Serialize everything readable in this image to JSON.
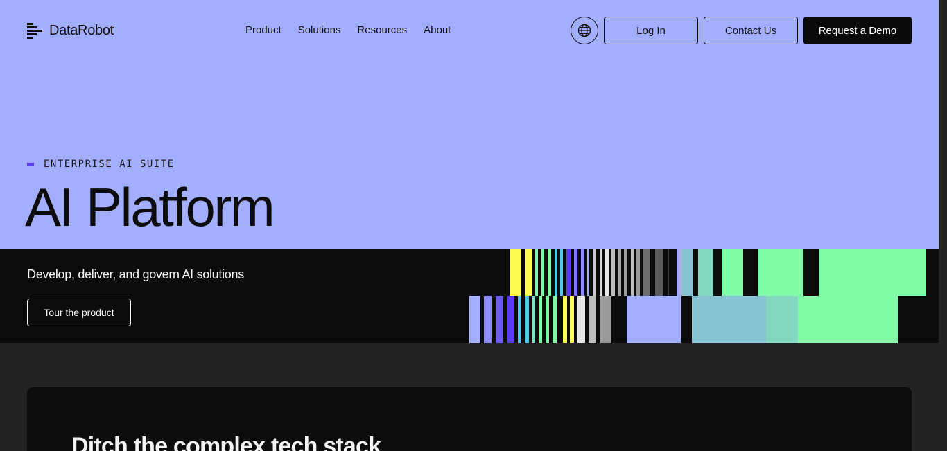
{
  "brand": {
    "name": "DataRobot"
  },
  "nav": {
    "items": [
      {
        "label": "Product"
      },
      {
        "label": "Solutions"
      },
      {
        "label": "Resources"
      },
      {
        "label": "About"
      }
    ]
  },
  "header": {
    "login_label": "Log In",
    "contact_label": "Contact Us",
    "demo_label": "Request a Demo"
  },
  "hero": {
    "eyebrow": "ENTERPRISE AI SUITE",
    "title": "AI Platform",
    "subtitle": "Develop, deliver, and govern AI solutions",
    "cta_label": "Tour the product"
  },
  "section": {
    "title": "Ditch the complex tech stack"
  },
  "colors": {
    "hero_bg": "#a4aefe",
    "band_bg": "#0b0b0b",
    "page_bg": "#232323",
    "accent": "#5b3df0",
    "yellow": "#fbfc52",
    "mint": "#80fca9",
    "lavender": "#a4aefe",
    "teal": "#87c3d2"
  },
  "icons": {
    "logo": "datarobot-logo-icon",
    "globe": "globe-icon"
  }
}
